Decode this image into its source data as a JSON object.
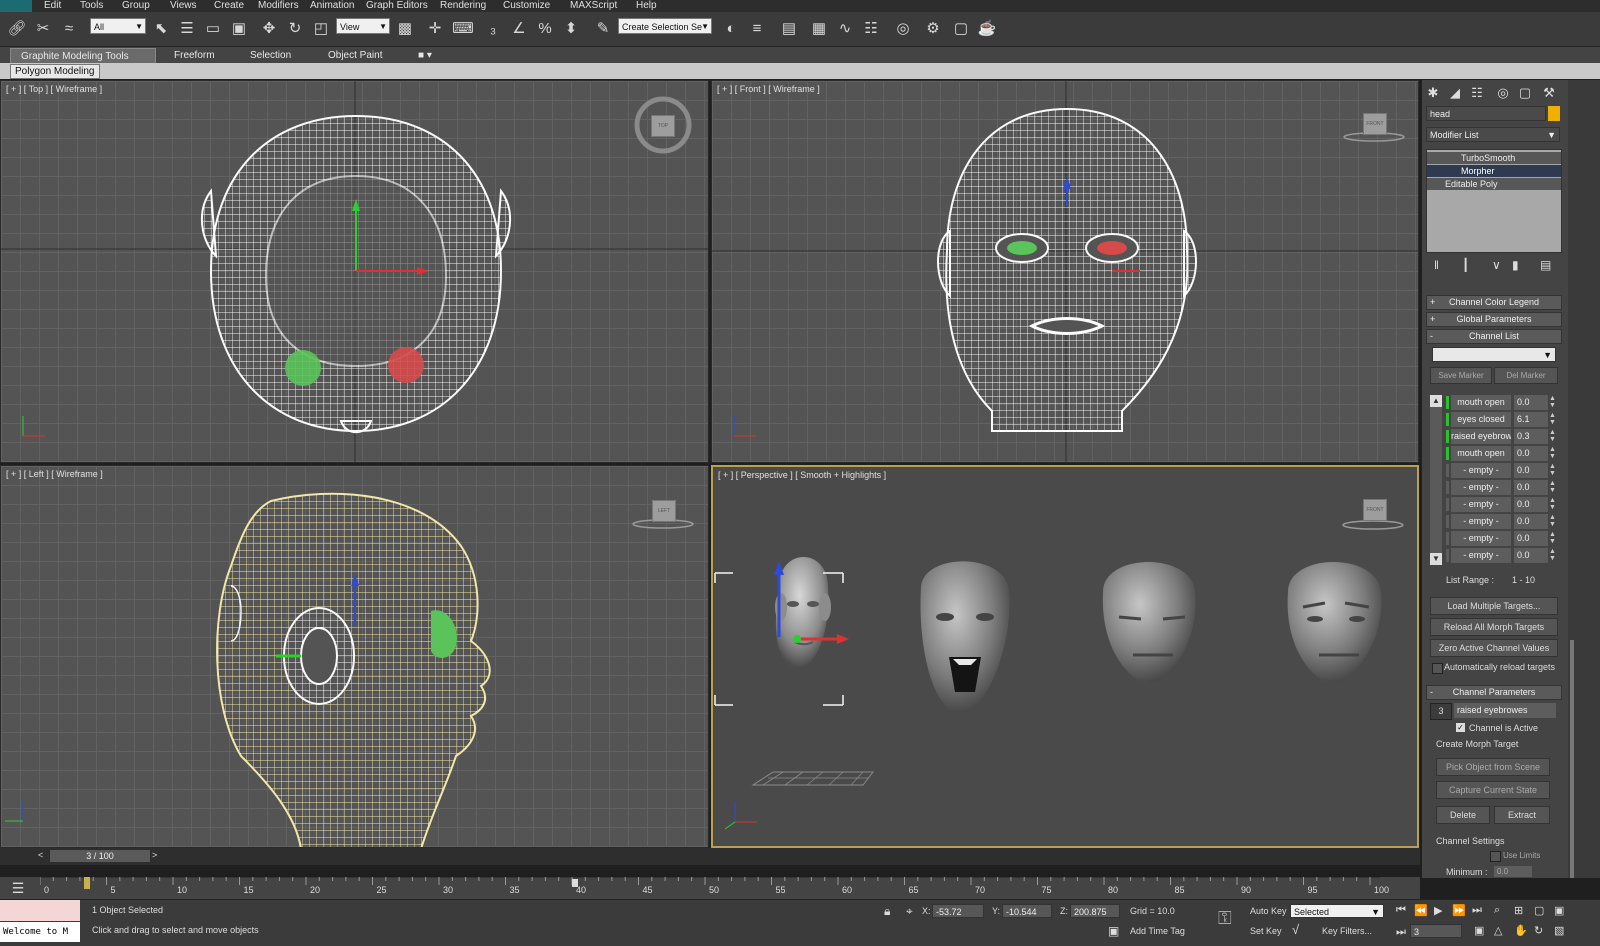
{
  "menu": [
    "Edit",
    "Tools",
    "Group",
    "Views",
    "Create",
    "Modifiers",
    "Animation",
    "Graph Editors",
    "Rendering",
    "Customize",
    "MAXScript",
    "Help"
  ],
  "toolbar": {
    "selection_filter": "All",
    "ref_coord": "View",
    "selection_set": "Create Selection Se"
  },
  "ribbon": {
    "tabs": [
      "Graphite Modeling Tools",
      "Freeform",
      "Selection",
      "Object Paint"
    ],
    "subpanel": "Polygon Modeling"
  },
  "viewports": {
    "top": "[ + ] [ Top ] [ Wireframe ]",
    "front": "[ + ] [ Front ] [ Wireframe ]",
    "left": "[ + ] [ Left ] [ Wireframe ]",
    "perspective": "[ + ] [ Perspective ] [ Smooth + Highlights ]"
  },
  "viewcube": {
    "top": "TOP",
    "front": "FRONT",
    "left": "LEFT",
    "persp": "FRONT"
  },
  "command_panel": {
    "object_name": "head",
    "modifier_list_label": "Modifier List",
    "stack": [
      "TurboSmooth",
      "Morpher",
      "Editable Poly"
    ],
    "rollouts": {
      "channel_color_legend": "Channel Color Legend",
      "global_parameters": "Global Parameters",
      "channel_list": "Channel List",
      "channel_parameters": "Channel Parameters"
    },
    "save_marker": "Save Marker",
    "del_marker": "Del Marker",
    "channels": [
      {
        "name": "mouth open",
        "value": "0.0"
      },
      {
        "name": "eyes closed",
        "value": "6.1"
      },
      {
        "name": "raised eyebrowe",
        "value": "0.3"
      },
      {
        "name": "mouth open",
        "value": "0.0"
      },
      {
        "name": "- empty -",
        "value": "0.0"
      },
      {
        "name": "- empty -",
        "value": "0.0"
      },
      {
        "name": "- empty -",
        "value": "0.0"
      },
      {
        "name": "- empty -",
        "value": "0.0"
      },
      {
        "name": "- empty -",
        "value": "0.0"
      },
      {
        "name": "- empty -",
        "value": "0.0"
      }
    ],
    "list_range_label": "List Range :",
    "list_range_value": "1 - 10",
    "buttons": {
      "load_multiple": "Load Multiple Targets...",
      "reload_all": "Reload All Morph Targets",
      "zero_active": "Zero Active Channel Values",
      "auto_reload": "Automatically reload targets",
      "pick_object": "Pick Object from Scene",
      "capture_state": "Capture Current State",
      "delete": "Delete",
      "extract": "Extract"
    },
    "channel_param": {
      "number": "3",
      "name": "raised eyebrowes",
      "active_label": "Channel is Active",
      "create_morph_target": "Create Morph Target",
      "channel_settings": "Channel Settings",
      "use_limits": "Use Limits",
      "minimum_label": "Minimum :",
      "minimum_value": "0.0"
    }
  },
  "timeline": {
    "frame": "3 / 100",
    "ticks": [
      "0",
      "5",
      "10",
      "15",
      "20",
      "25",
      "30",
      "35",
      "40",
      "45",
      "50",
      "55",
      "60",
      "65",
      "70",
      "75",
      "80",
      "85",
      "90",
      "95",
      "100"
    ]
  },
  "status": {
    "selected": "1 Object Selected",
    "prompt": "Click and drag to select and move objects",
    "listener": "Welcome to M",
    "x_label": "X:",
    "x": "-53.72",
    "y_label": "Y:",
    "y": "-10.544",
    "z_label": "Z:",
    "z": "200.875",
    "grid": "Grid = 10.0",
    "add_time_tag": "Add Time Tag",
    "auto_key": "Auto Key",
    "set_key": "Set Key",
    "key_mode": "Selected",
    "key_filters": "Key Filters...",
    "current_frame": "3"
  },
  "colors": {
    "accent_yellow": "#b9a24a",
    "channel_green": "#2ac12a",
    "wire_white": "#f4f4f4",
    "wire_yellow": "#f2e6a8"
  }
}
